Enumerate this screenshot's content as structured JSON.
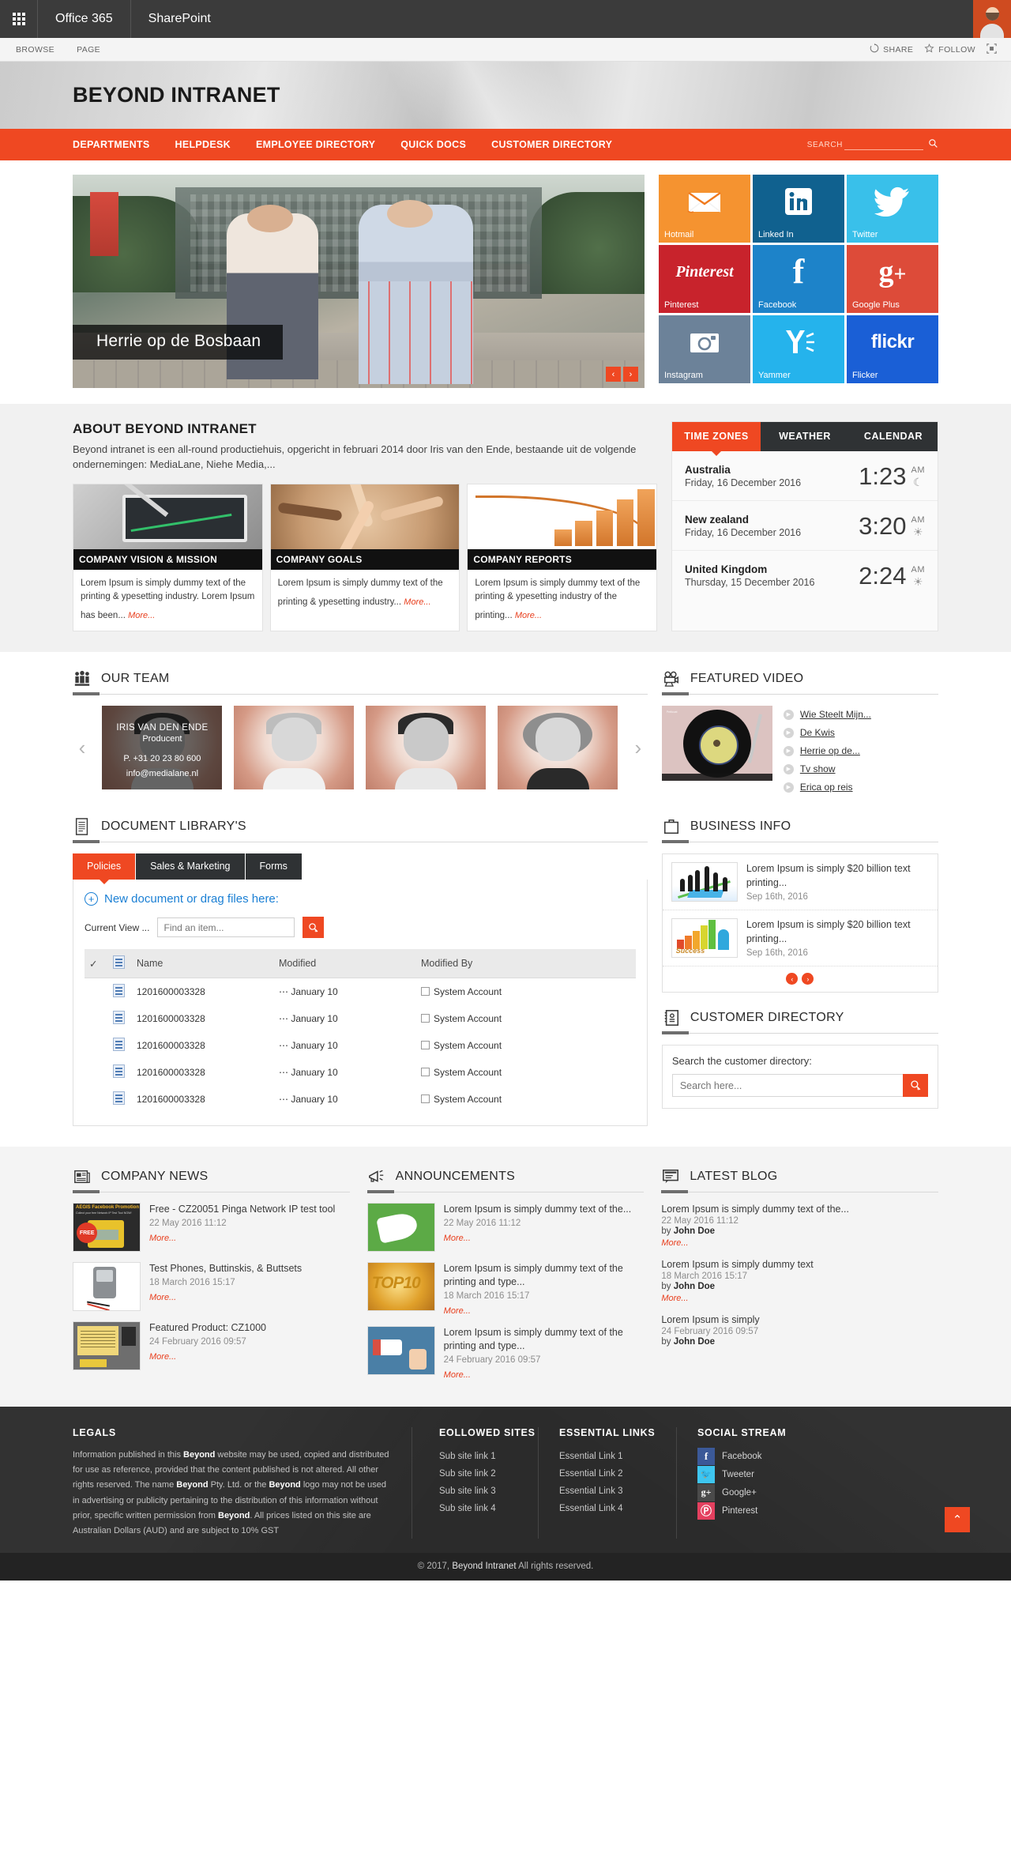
{
  "suite": {
    "waffle_label": "app-launcher",
    "office": "Office 365",
    "sharepoint": "SharePoint"
  },
  "ribbon": {
    "tabs": [
      "BROWSE",
      "PAGE"
    ],
    "share": "SHARE",
    "follow": "FOLLOW",
    "focus": "focus-on-content"
  },
  "header": {
    "site_title": "BEYOND INTRANET"
  },
  "nav": {
    "items": [
      "DEPARTMENTS",
      "HELPDESK",
      "EMPLOYEE DIRECTORY",
      "QUICK DOCS",
      "CUSTOMER DIRECTORY"
    ],
    "search_label": "SEARCH"
  },
  "hero": {
    "caption": "Herrie op de Bosbaan",
    "prev": "‹",
    "next": "›"
  },
  "tiles": [
    {
      "label": "Hotmail",
      "bg": "#f59330",
      "icon": "hotmail-icon"
    },
    {
      "label": "Linked In",
      "bg": "#10618f",
      "icon": "linkedin-icon"
    },
    {
      "label": "Twitter",
      "bg": "#39c0ea",
      "icon": "twitter-icon"
    },
    {
      "label": "Pinterest",
      "bg": "#c8232c",
      "icon": "pinterest-icon"
    },
    {
      "label": "Facebook",
      "bg": "#1d83c9",
      "icon": "facebook-icon"
    },
    {
      "label": "Google Plus",
      "bg": "#dd4b39",
      "icon": "googleplus-icon"
    },
    {
      "label": "Instagram",
      "bg": "#6c8299",
      "icon": "instagram-icon"
    },
    {
      "label": "Yammer",
      "bg": "#25b3ec",
      "icon": "yammer-icon"
    },
    {
      "label": "Flicker",
      "bg": "#1a5fd6",
      "icon": "flickr-icon"
    }
  ],
  "about": {
    "title": "ABOUT BEYOND INTRANET",
    "description": "Beyond intranet is een all-round productiehuis, opgericht in februari 2014 door Iris van den Ende, bestaande uit de volgende ondernemingen: MediaLane, Niehe Media,...",
    "cards": [
      {
        "caption": "COMPANY VISION & MISSION",
        "body": "Lorem Ipsum is simply dummy text of the printing & ypesetting industry. Lorem Ipsum has been...",
        "more": "More..."
      },
      {
        "caption": "COMPANY GOALS",
        "body": "Lorem Ipsum is simply dummy text of the printing & ypesetting industry...",
        "more": "More..."
      },
      {
        "caption": "COMPANY REPORTS",
        "body": "Lorem Ipsum is simply dummy text of the printing & ypesetting industry of the printing...",
        "more": "More..."
      }
    ]
  },
  "timezones": {
    "tabs": [
      "TIME ZONES",
      "WEATHER",
      "CALENDAR"
    ],
    "active_tab": "TIME ZONES",
    "rows": [
      {
        "country": "Australia",
        "date": "Friday, 16 December 2016",
        "time": "1:23",
        "ampm": "AM",
        "weather": "moon"
      },
      {
        "country": "New zealand",
        "date": "Friday, 16 December 2016",
        "time": "3:20",
        "ampm": "AM",
        "weather": "sun"
      },
      {
        "country": "United Kingdom",
        "date": "Thursday, 15 December 2016",
        "time": "2:24",
        "ampm": "AM",
        "weather": "sun"
      }
    ]
  },
  "team": {
    "title": "OUR TEAM",
    "prev": "‹",
    "next": "›",
    "active_member": {
      "name": "IRIS VAN DEN ENDE",
      "role": "Producent",
      "phone": "P. +31 20 23 80 600",
      "email": "info@medialane.nl"
    }
  },
  "video": {
    "title": "FEATURED VIDEO",
    "player_caption": "Petticoat",
    "items": [
      "Wie Steelt Mijn...",
      "De Kwis",
      "Herrie op de...",
      "Tv show",
      "Erica op reis"
    ]
  },
  "doclib": {
    "title": "DOCUMENT LIBRARY'S",
    "tabs": [
      "Policies",
      "Sales & Marketing",
      "Forms"
    ],
    "active_tab": "Policies",
    "new_document": "New document or drag files here:",
    "current_view_label": "Current View ...",
    "find_placeholder": "Find an item...",
    "columns": [
      "✓",
      "doc-icon",
      "Name",
      "Modified",
      "Modified By"
    ],
    "rows": [
      {
        "name": "1201600003328",
        "modified": "⋯ January 10",
        "modified_by": "System Account"
      },
      {
        "name": "1201600003328",
        "modified": "⋯ January 10",
        "modified_by": "System Account"
      },
      {
        "name": "1201600003328",
        "modified": "⋯ January 10",
        "modified_by": "System Account"
      },
      {
        "name": "1201600003328",
        "modified": "⋯ January 10",
        "modified_by": "System Account"
      },
      {
        "name": "1201600003328",
        "modified": "⋯ January 10",
        "modified_by": "System Account"
      }
    ]
  },
  "business": {
    "title": "BUSINESS INFO",
    "items": [
      {
        "title": "Lorem Ipsum is simply  $20 billion text printing...",
        "date": "Sep 16th, 2016"
      },
      {
        "title": "Lorem Ipsum is simply  $20 billion text printing...",
        "date": "Sep 16th, 2016"
      }
    ],
    "prev": "‹",
    "next": "›"
  },
  "customer_directory": {
    "title": "CUSTOMER DIRECTORY",
    "label": "Search the customer directory:",
    "placeholder": "Search here..."
  },
  "company_news": {
    "title": "COMPANY NEWS",
    "items": [
      {
        "title": "Free - CZ20051 Pinga Network IP test tool",
        "date": "22 May 2016 11:12",
        "more": "More..."
      },
      {
        "title": "Test Phones, Buttinskis, & Buttsets",
        "date": "18 March 2016 15:17",
        "more": "More..."
      },
      {
        "title": "Featured Product: CZ1000",
        "date": "24 February 2016 09:57",
        "more": "More..."
      }
    ]
  },
  "announcements": {
    "title": "ANNOUNCEMENTS",
    "items": [
      {
        "title": "Lorem Ipsum is simply dummy text of the...",
        "date": "22 May 2016 11:12",
        "more": "More..."
      },
      {
        "title": "Lorem Ipsum is simply dummy text of the printing and type...",
        "date": "18 March 2016 15:17",
        "more": "More..."
      },
      {
        "title": "Lorem Ipsum is simply dummy text of the printing and type...",
        "date": "24 February 2016 09:57",
        "more": "More..."
      }
    ]
  },
  "latest_blog": {
    "title": "LATEST BLOG",
    "items": [
      {
        "title": "Lorem Ipsum is simply dummy text of the...",
        "date": "22 May 2016 11:12",
        "by_prefix": "by ",
        "author": "John Doe",
        "more": "More..."
      },
      {
        "title": "Lorem Ipsum is simply dummy text",
        "date": "18 March 2016 15:17",
        "by_prefix": "by ",
        "author": "John Doe",
        "more": "More..."
      },
      {
        "title": "Lorem Ipsum is simply",
        "date": "24 February 2016 09:57",
        "by_prefix": "by ",
        "author": "John Doe",
        "more": "More..."
      }
    ]
  },
  "footer": {
    "legals_title": "LEGALS",
    "legals_text_parts": [
      "Information published in this ",
      "Beyond",
      " website may be used, copied and distributed for use as reference, provided that the content published is not altered. All other rights reserved. The name ",
      "Beyond",
      " Pty. Ltd. or the ",
      "Beyond",
      " logo may not be used in advertising or publicity pertaining to the distribution of this information without prior, specific written permission from ",
      "Beyond",
      ". All prices listed on this site are Australian Dollars (AUD) and are subject to 10% GST"
    ],
    "sites_title": "EOLLOWED SITES",
    "sites": [
      "Sub site link 1",
      "Sub site link 2",
      "Sub site link 3",
      "Sub site link 4"
    ],
    "links_title": "ESSENTIAL LINKS",
    "links": [
      "Essential Link 1",
      "Essential Link 2",
      "Essential Link 3",
      "Essential Link 4"
    ],
    "social_title": "SOCIAL STREAM",
    "social": [
      {
        "name": "Facebook",
        "glyph": "f",
        "bg": "#3b5998"
      },
      {
        "name": "Tweeter",
        "glyph": "🐦",
        "bg": "#3ec6f0"
      },
      {
        "name": "Google+",
        "glyph": "g+",
        "bg": "#4a4a4a"
      },
      {
        "name": "Pinterest",
        "glyph": "Ⓟ",
        "bg": "#e4405f"
      }
    ],
    "back_to_top": "⌃",
    "copyright_prefix": "© 2017, ",
    "copyright_brand": "Beyond Intranet",
    "copyright_suffix": " All rights reserved."
  },
  "colors": {
    "accent": "#ef4822",
    "dark": "#2f3234",
    "suitebar": "#3b3b3b"
  }
}
